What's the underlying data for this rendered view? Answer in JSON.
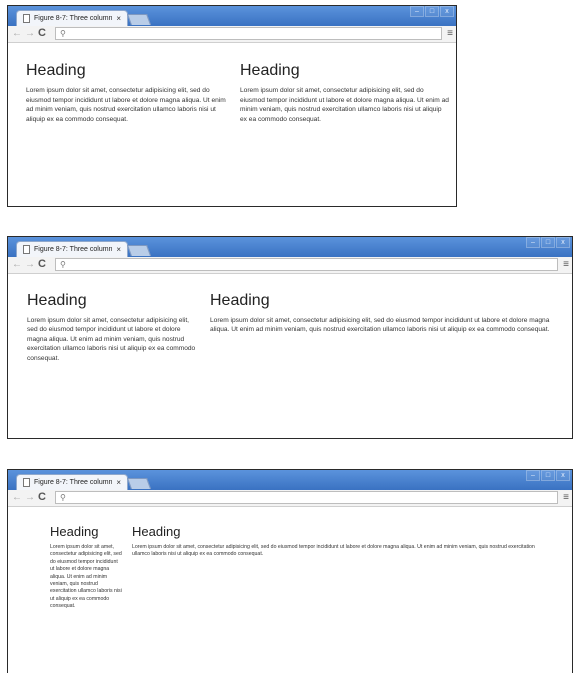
{
  "tab_title": "Figure 8-7: Three column",
  "tab_close": "×",
  "nav": {
    "back": "←",
    "forward": "→",
    "reload": "C",
    "search_icon": "⚲",
    "menu": "≡"
  },
  "window_controls": {
    "minimize": "–",
    "maximize": "□",
    "close": "x"
  },
  "heading": "Heading",
  "lorem": "Lorem ipsum dolor sit amet, consectetur adipisicing elit, sed do eiusmod tempor incididunt ut labore et dolore magna aliqua. Ut enim ad minim veniam, quis nostrud exercitation ullamco laboris nisi ut aliquip ex ea commodo consequat.",
  "colors": {
    "titlebar": "#3f79c8",
    "window_border": "#2a2a2a",
    "tab": "#f2f5fa"
  }
}
